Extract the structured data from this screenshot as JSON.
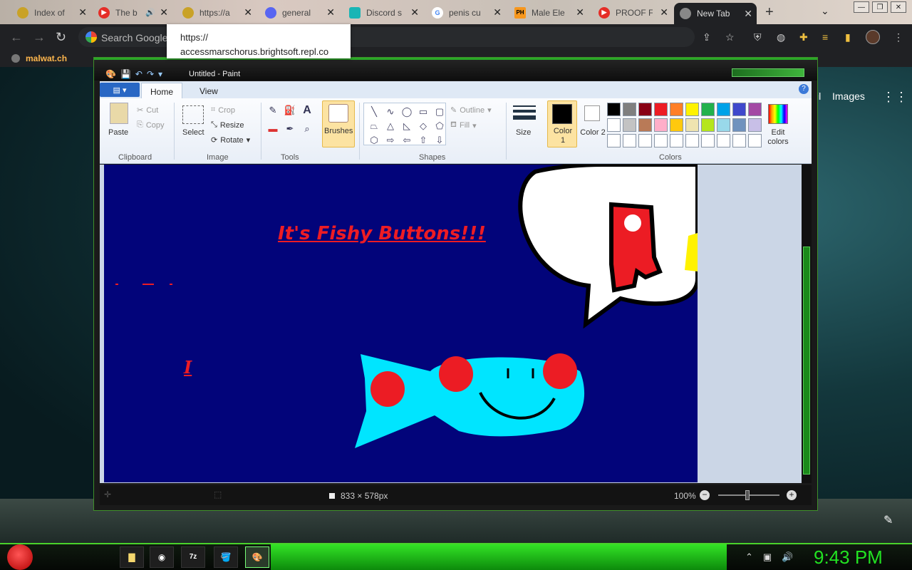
{
  "browser": {
    "tabs": [
      {
        "label": "Index of",
        "fav_color": "#c9a227",
        "fav_glyph": ""
      },
      {
        "label": "The b",
        "fav_color": "#e52d27",
        "fav_glyph": "▶"
      },
      {
        "label": "https://a",
        "fav_color": "#c9a227",
        "fav_glyph": ""
      },
      {
        "label": "general",
        "fav_color": "#5865f2",
        "fav_glyph": ""
      },
      {
        "label": "Discord s",
        "fav_color": "#19b5b5",
        "fav_glyph": ""
      },
      {
        "label": "penis cu",
        "fav_color": "#4285f4",
        "fav_glyph": "G"
      },
      {
        "label": "Male Ele",
        "fav_color": "#f7971d",
        "fav_glyph": "PH"
      },
      {
        "label": "PROOF F",
        "fav_color": "#e52d27",
        "fav_glyph": "▶"
      },
      {
        "label": "New Tab",
        "fav_color": "#888888",
        "fav_glyph": ""
      }
    ],
    "new_tab_symbol": "+",
    "omnibox_placeholder": "Search Google or type a URL",
    "omnibox_visible": "Search Google",
    "tooltip_line1": "https://",
    "tooltip_line2": "accessmarschorus.brightsoft.repl.co",
    "bookmark": "malwat.ch"
  },
  "google_page": {
    "images_link": "Images",
    "il_fragment": "il"
  },
  "paint": {
    "title": "Untitled - Paint",
    "ribbon_tabs": [
      "Home",
      "View"
    ],
    "clipboard": {
      "paste": "Paste",
      "cut": "Cut",
      "copy": "Copy",
      "label": "Clipboard"
    },
    "image": {
      "select": "Select",
      "crop": "Crop",
      "resize": "Resize",
      "rotate": "Rotate",
      "label": "Image"
    },
    "tools_label": "Tools",
    "brushes": "Brushes",
    "shapes": {
      "outline": "Outline",
      "fill": "Fill",
      "label": "Shapes"
    },
    "size": "Size",
    "color1": "Color 1",
    "color2": "Color 2",
    "edit_colors": "Edit colors",
    "colors_label": "Colors",
    "palette_row1": [
      "#000000",
      "#7f7f7f",
      "#880015",
      "#ed1c24",
      "#ff7f27",
      "#fff200",
      "#22b14c",
      "#00a2e8",
      "#3f48cc",
      "#a349a4"
    ],
    "palette_row2": [
      "#ffffff",
      "#c3c3c3",
      "#b97a57",
      "#ffaec9",
      "#ffc90e",
      "#efe4b0",
      "#b5e61d",
      "#99d9ea",
      "#7092be",
      "#c8bfe7"
    ],
    "palette_row3": [
      "#ffffff",
      "#ffffff",
      "#ffffff",
      "#ffffff",
      "#ffffff",
      "#ffffff",
      "#ffffff",
      "#ffffff",
      "#ffffff",
      "#ffffff"
    ],
    "canvas_text": "It's Fishy Buttons!!!",
    "canvas_cursor_char": "I",
    "canvas_bg": "#02047a",
    "dimensions": "833 × 578px",
    "zoom": "100%"
  },
  "taskbar": {
    "clock": "9:43 PM",
    "apps": [
      "folder",
      "chrome",
      "7z",
      "paint-bucket",
      "paint"
    ]
  }
}
